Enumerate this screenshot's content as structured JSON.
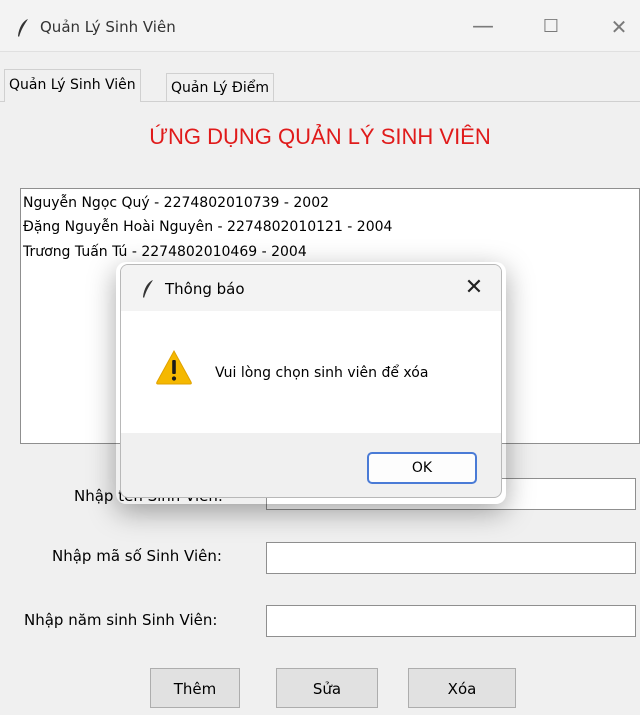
{
  "window": {
    "title": "Quản Lý Sinh Viên",
    "controls": {
      "minimize": "—",
      "maximize": "☐",
      "close": "✕"
    }
  },
  "tabs": [
    {
      "label": "Quản Lý Sinh Viên",
      "active": true
    },
    {
      "label": "Quản Lý Điểm",
      "active": false
    }
  ],
  "app_title": "ỨNG DỤNG QUẢN LÝ SINH VIÊN",
  "students": [
    "Nguyễn Ngọc Quý - 2274802010739 - 2002",
    "Đặng Nguyễn Hoài Nguyên - 2274802010121 - 2004",
    "Trương Tuấn Tú - 2274802010469 - 2004"
  ],
  "form": {
    "name_label": "Nhập tên Sinh Viên:",
    "name_label_visible": "Nhập",
    "id_label": "Nhập mã số Sinh Viên:",
    "birth_label": "Nhập năm sinh Sinh Viên:",
    "name_value": "",
    "id_value": "",
    "birth_value": ""
  },
  "buttons": {
    "add": "Thêm",
    "edit": "Sửa",
    "delete": "Xóa"
  },
  "dialog": {
    "title": "Thông báo",
    "message": "Vui lòng chọn sinh viên để xóa",
    "ok": "OK",
    "close": "✕",
    "icon": "warning-icon"
  },
  "colors": {
    "title_red": "#e01b1b",
    "ok_border": "#4a7bd6",
    "warning_yellow": "#f5b800"
  }
}
